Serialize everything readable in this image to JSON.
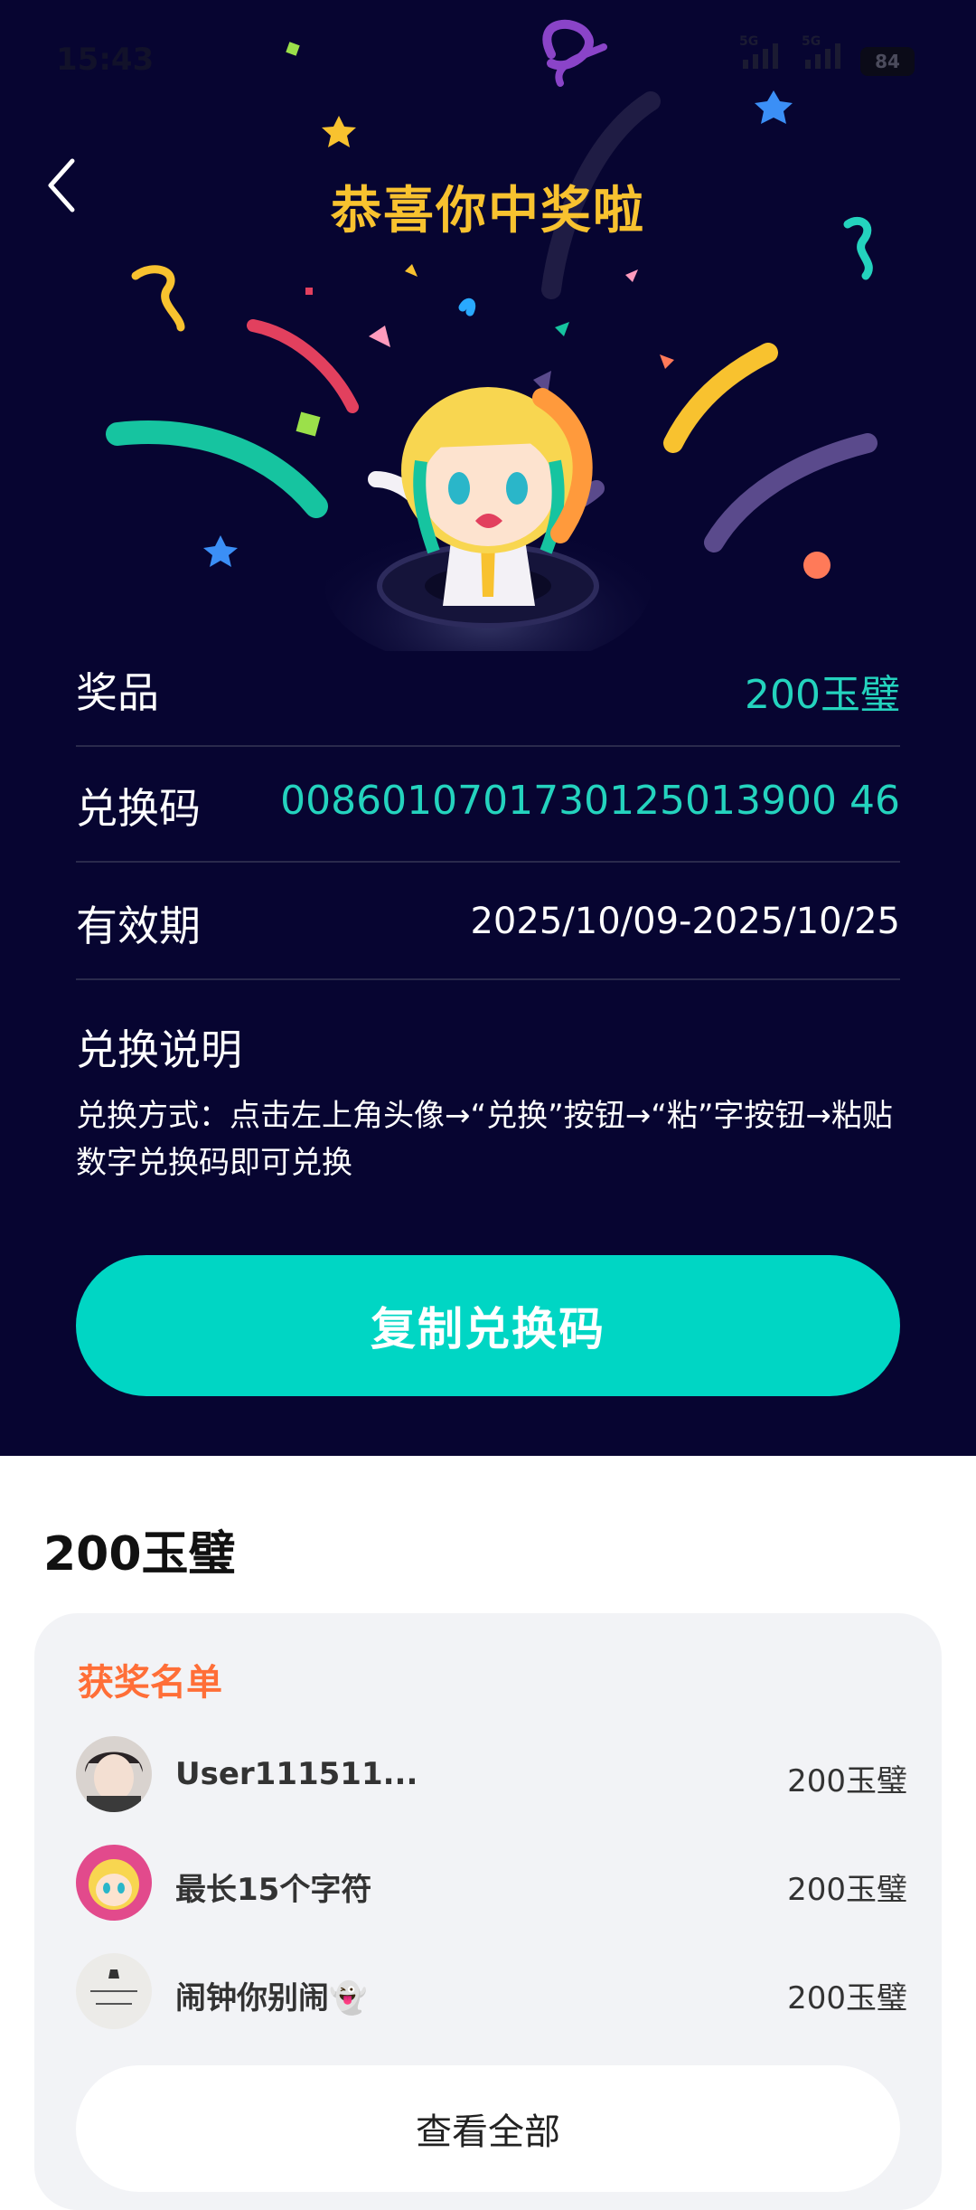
{
  "status_bar": {
    "time": "15:43",
    "signal1_tag": "5G",
    "signal2_tag": "5G",
    "battery": "84"
  },
  "header": {
    "title": "恭喜你中奖啦"
  },
  "prize_info": {
    "prize_label": "奖品",
    "prize_value": "200玉璧",
    "code_label": "兑换码",
    "code_value": "0086010701730125013900 46",
    "validity_label": "有效期",
    "validity_value": "2025/10/09-2025/10/25",
    "instructions_title": "兑换说明",
    "instructions_text": "兑换方式：点击左上角头像→“兑换”按钮→“粘”字按钮→粘贴数字兑换码即可兑换"
  },
  "copy_button": {
    "label": "复制兑换码"
  },
  "prize_section": {
    "heading": "200玉璧"
  },
  "winners": {
    "title": "获奖名单",
    "items": [
      {
        "name": "User111511...",
        "prize": "200玉璧"
      },
      {
        "name": "最长15个字符",
        "prize": "200玉璧"
      },
      {
        "name": "闹钟你别闹👻",
        "prize": "200玉璧"
      }
    ],
    "view_all": "查看全部"
  }
}
